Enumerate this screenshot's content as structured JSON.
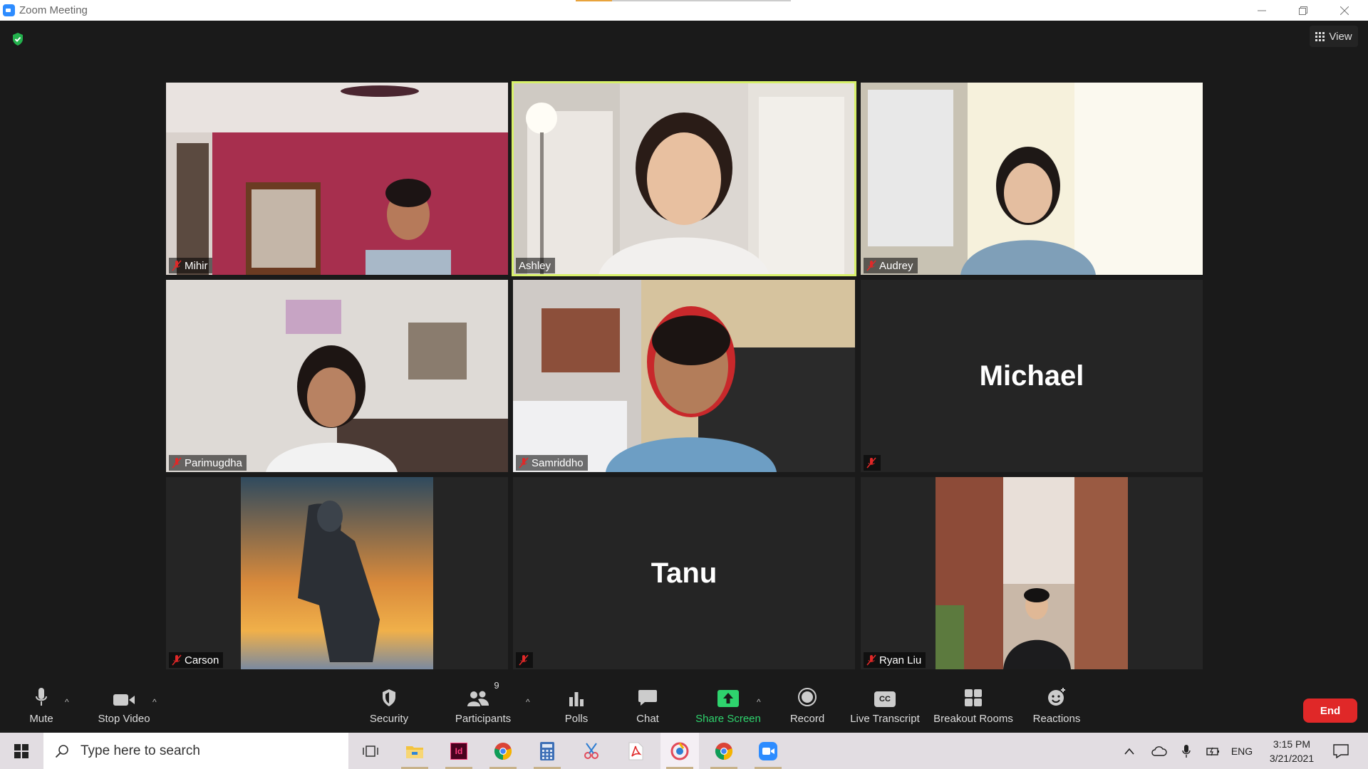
{
  "window": {
    "title": "Zoom Meeting",
    "progress_fraction": 0.17,
    "progress_color": "#e8a33c",
    "minimize_icon": "minimize-icon",
    "restore_icon": "restore-icon",
    "close_icon": "close-icon"
  },
  "meeting": {
    "view_label": "View",
    "active_speaker_color": "#d7f06a",
    "participants": [
      {
        "name": "Mihir",
        "muted": true,
        "video": "room with red wall and bookshelf"
      },
      {
        "name": "Ashley",
        "muted": false,
        "active": true,
        "video": "room with white door"
      },
      {
        "name": "Audrey",
        "muted": true,
        "video": "bright room with blinds"
      },
      {
        "name": "Parimugdha",
        "muted": true,
        "video": "white room"
      },
      {
        "name": "Samriddho",
        "muted": true,
        "video": "bedroom with headphones"
      },
      {
        "name": "Michael",
        "muted": true,
        "video_off": true
      },
      {
        "name": "Carson",
        "muted": true,
        "video": "profile picture"
      },
      {
        "name": "Tanu",
        "muted": true,
        "video_off": true
      },
      {
        "name": "Ryan Liu",
        "muted": true,
        "video": "profile picture"
      }
    ]
  },
  "toolbar": {
    "mute": "Mute",
    "stop_video": "Stop Video",
    "security": "Security",
    "participants": "Participants",
    "participants_count": "9",
    "polls": "Polls",
    "chat": "Chat",
    "share_screen": "Share Screen",
    "record": "Record",
    "live_transcript": "Live Transcript",
    "live_transcript_badge": "CC",
    "breakout_rooms": "Breakout Rooms",
    "reactions": "Reactions",
    "end": "End",
    "share_color": "#2ed36d",
    "end_color": "#e02828"
  },
  "taskbar": {
    "search_placeholder": "Type here to search",
    "apps": [
      "task-view-icon",
      "file-explorer-icon",
      "indesign-icon",
      "chrome-icon",
      "calculator-icon",
      "snipping-tool-icon",
      "acrobat-icon",
      "photo-app-icon",
      "chrome-icon",
      "zoom-icon"
    ],
    "indesign_label": "Id",
    "language": "ENG",
    "time": "3:15 PM",
    "date": "3/21/2021"
  }
}
